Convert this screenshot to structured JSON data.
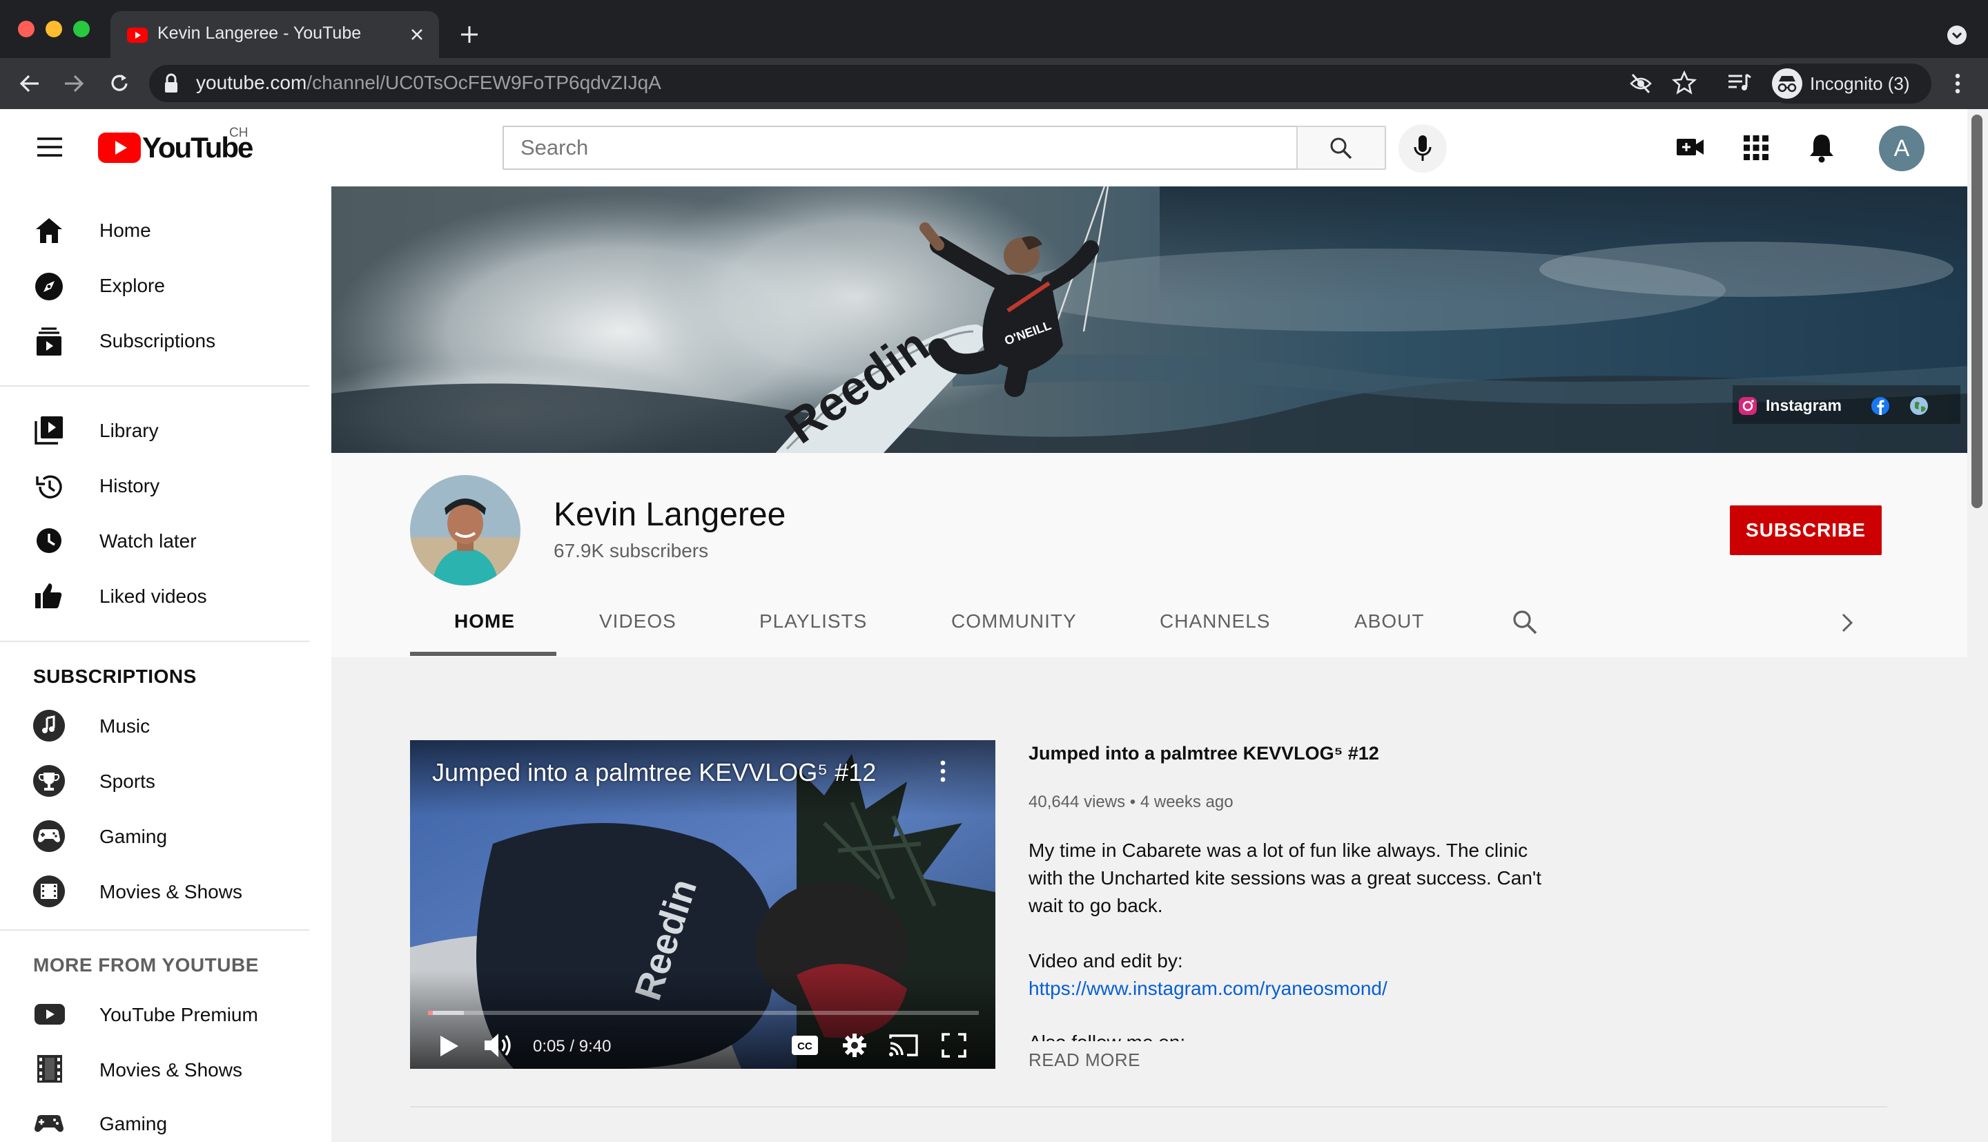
{
  "colors": {
    "chrome_dark": "#202124",
    "chrome_mid": "#35363a",
    "youtube_red": "#ff0000",
    "subscribe_red": "#cc0000",
    "link_blue": "#065fd4"
  },
  "browser": {
    "tab_title": "Kevin Langeree - YouTube",
    "url_host": "youtube.com",
    "url_path": "/channel/UC0TsOcFEW9FoTP6qdvZIJqA",
    "incognito_label": "Incognito (3)"
  },
  "masthead": {
    "logo_text": "YouTube",
    "country_code": "CH",
    "search_placeholder": "Search",
    "avatar_letter": "A"
  },
  "sidebar": {
    "primary": [
      {
        "label": "Home",
        "icon": "home-icon"
      },
      {
        "label": "Explore",
        "icon": "compass-icon"
      },
      {
        "label": "Subscriptions",
        "icon": "subscriptions-icon"
      }
    ],
    "library": [
      {
        "label": "Library",
        "icon": "library-icon"
      },
      {
        "label": "History",
        "icon": "history-icon"
      },
      {
        "label": "Watch later",
        "icon": "clock-icon"
      },
      {
        "label": "Liked videos",
        "icon": "thumbs-up-icon"
      }
    ],
    "subscriptions_heading": "SUBSCRIPTIONS",
    "subscriptions": [
      {
        "label": "Music",
        "icon": "music-note-icon"
      },
      {
        "label": "Sports",
        "icon": "trophy-icon"
      },
      {
        "label": "Gaming",
        "icon": "gamepad-icon"
      },
      {
        "label": "Movies & Shows",
        "icon": "film-icon"
      }
    ],
    "more_heading": "MORE FROM YOUTUBE",
    "more": [
      {
        "label": "YouTube Premium",
        "icon": "youtube-premium-icon"
      },
      {
        "label": "Movies & Shows",
        "icon": "film-strip-icon"
      },
      {
        "label": "Gaming",
        "icon": "gamepad-icon"
      }
    ]
  },
  "banner": {
    "links": [
      "Instagram"
    ],
    "board_text": "Reedin",
    "wetsuit_text": "O'NEILL"
  },
  "channel": {
    "name": "Kevin Langeree",
    "subscribers": "67.9K subscribers",
    "subscribe_label": "SUBSCRIBE",
    "tabs": [
      "HOME",
      "VIDEOS",
      "PLAYLISTS",
      "COMMUNITY",
      "CHANNELS",
      "ABOUT"
    ],
    "active_tab": "HOME"
  },
  "featured": {
    "player_title": "Jumped into a palmtree KEVVLOG⁵ #12",
    "player_time": "0:05 / 9:40",
    "progress_fraction": 0.009,
    "title": "Jumped into a palmtree KEVVLOG⁵ #12",
    "views": "40,644 views",
    "age": "4 weeks ago",
    "description_lines": [
      "My time in Cabarete was a lot of fun like always. The clinic",
      "with the Uncharted kite sessions was a great success. Can't",
      "wait to go back."
    ],
    "credit_line": "Video and edit by:",
    "credit_link": "https://www.instagram.com/ryaneosmond/",
    "cut_line": "Also follow me on:",
    "read_more": "READ MORE"
  }
}
